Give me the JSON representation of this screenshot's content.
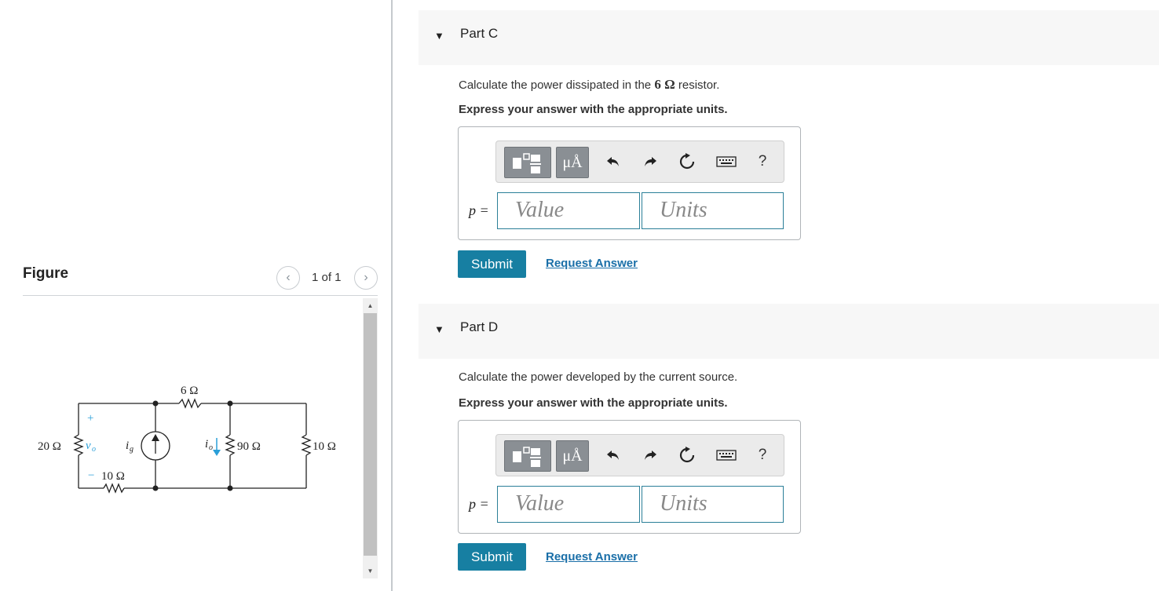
{
  "figure": {
    "title": "Figure",
    "page_counter": "1 of 1",
    "prev_icon": "‹",
    "next_icon": "›",
    "circuit": {
      "r_top": "6 Ω",
      "r_left": "20 Ω",
      "r_bottom": "10 Ω",
      "r_middle": "90 Ω",
      "r_right": "10 Ω",
      "plus": "+",
      "minus": "−",
      "vo": "v",
      "vo_sub": "o",
      "ig": "i",
      "ig_sub": "g",
      "io": "i",
      "io_sub": "o"
    }
  },
  "parts": [
    {
      "title": "Part C",
      "question_before": "Calculate the power dissipated in the ",
      "question_bold": "6 Ω",
      "question_after": " resistor.",
      "instruction": "Express your answer with the appropriate units.",
      "variable": "p =",
      "value_placeholder": "Value",
      "units_placeholder": "Units",
      "units_button": "μÅ",
      "help_label": "?",
      "submit_label": "Submit",
      "request_label": "Request Answer"
    },
    {
      "title": "Part D",
      "question_before": "Calculate the power developed by the current source.",
      "question_bold": "",
      "question_after": "",
      "instruction": "Express your answer with the appropriate units.",
      "variable": "p =",
      "value_placeholder": "Value",
      "units_placeholder": "Units",
      "units_button": "μÅ",
      "help_label": "?",
      "submit_label": "Submit",
      "request_label": "Request Answer"
    }
  ],
  "icons": [
    "templates-icon",
    "units-icon",
    "undo-icon",
    "redo-icon",
    "reset-icon",
    "keyboard-icon",
    "help-icon",
    "collapse-triangle-icon"
  ],
  "colors": {
    "accent": "#177fa2",
    "link": "#1a6fa8",
    "field_border": "#2b7f98",
    "toolbar_button": "#8a8f94"
  }
}
